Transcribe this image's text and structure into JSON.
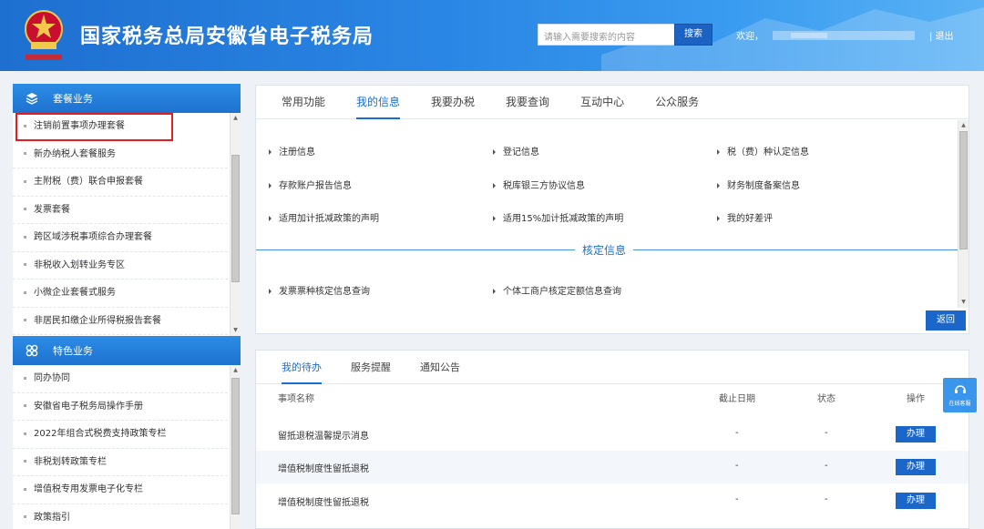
{
  "header": {
    "title": "国家税务总局安徽省电子税务局",
    "search_placeholder": "请输入需要搜索的内容",
    "search_label": "搜索",
    "welcome": "欢迎，",
    "logout": "| 退出"
  },
  "sidebar": {
    "group1": {
      "title": "套餐业务",
      "items": [
        "注销前置事项办理套餐",
        "新办纳税人套餐服务",
        "主附税（费）联合申报套餐",
        "发票套餐",
        "跨区域涉税事项综合办理套餐",
        "非税收入划转业务专区",
        "小微企业套餐式服务",
        "非居民扣缴企业所得税报告套餐"
      ]
    },
    "group2": {
      "title": "特色业务",
      "items": [
        "同办协同",
        "安徽省电子税务局操作手册",
        "2022年组合式税费支持政策专栏",
        "非税划转政策专栏",
        "增值税专用发票电子化专栏",
        "政策指引"
      ]
    }
  },
  "main": {
    "tabs": [
      "常用功能",
      "我的信息",
      "我要办税",
      "我要查询",
      "互动中心",
      "公众服务"
    ],
    "active_tab": "我的信息",
    "links": [
      "注册信息",
      "登记信息",
      "税（费）种认定信息",
      "存款账户报告信息",
      "税库银三方协议信息",
      "财务制度备案信息",
      "适用加计抵减政策的声明",
      "适用15%加计抵减政策的声明",
      "我的好差评"
    ],
    "section_title": "核定信息",
    "section_links": [
      "发票票种核定信息查询",
      "个体工商户核定定额信息查询"
    ],
    "back_label": "返回"
  },
  "todo": {
    "tabs": [
      "我的待办",
      "服务提醒",
      "通知公告"
    ],
    "columns": [
      "事项名称",
      "截止日期",
      "状态",
      "操作"
    ],
    "rows": [
      {
        "name": "留抵退税温馨提示消息",
        "deadline": "-",
        "status": "-",
        "action": "办理"
      },
      {
        "name": "增值税制度性留抵退税",
        "deadline": "-",
        "status": "-",
        "action": "办理"
      },
      {
        "name": "增值税制度性留抵退税",
        "deadline": "-",
        "status": "-",
        "action": "办理"
      }
    ]
  },
  "float_service": {
    "label": "在线客服"
  },
  "colors": {
    "primary": "#1a6ed0",
    "header_start": "#1e6fd0",
    "highlight_border": "#e02020"
  }
}
